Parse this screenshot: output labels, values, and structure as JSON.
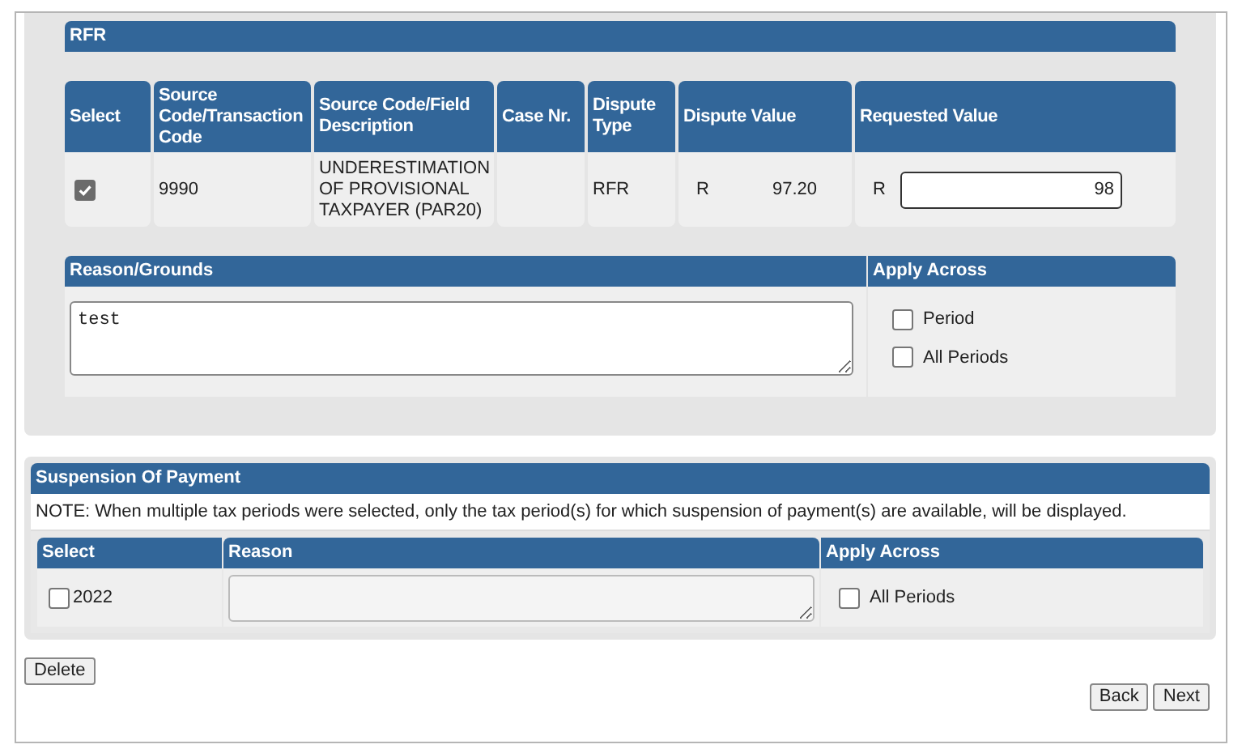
{
  "rfr": {
    "title": "RFR",
    "columns": [
      "Select",
      "Source Code/Transaction Code",
      "Source Code/Field Description",
      "Case Nr.",
      "Dispute Type",
      "Dispute Value",
      "Requested Value"
    ],
    "rows": [
      {
        "checked": true,
        "source_code": "9990",
        "description": "UNDERESTIMATION OF PROVISIONAL TAXPAYER (PAR20)",
        "dispute_type": "RFR",
        "dispute_currency": "R",
        "dispute_value": "97.20",
        "requested_currency": "R",
        "requested_value": "98"
      }
    ]
  },
  "reason": {
    "title": "Reason/Grounds",
    "value": "test",
    "apply_title": "Apply Across",
    "options": [
      {
        "label": "Period",
        "checked": false
      },
      {
        "label": "All Periods",
        "checked": false
      }
    ]
  },
  "suspension": {
    "title": "Suspension Of Payment",
    "note": "NOTE: When multiple tax periods were selected, only the tax period(s) for which suspension of payment(s) are available, will be displayed.",
    "columns": [
      "Select",
      "Reason",
      "Apply Across"
    ],
    "rows": [
      {
        "label": "2022",
        "checked": false,
        "apply_label": "All Periods",
        "apply_checked": false
      }
    ]
  },
  "delete_button": "Delete",
  "nav_buttons": [
    "Back",
    "Next"
  ]
}
